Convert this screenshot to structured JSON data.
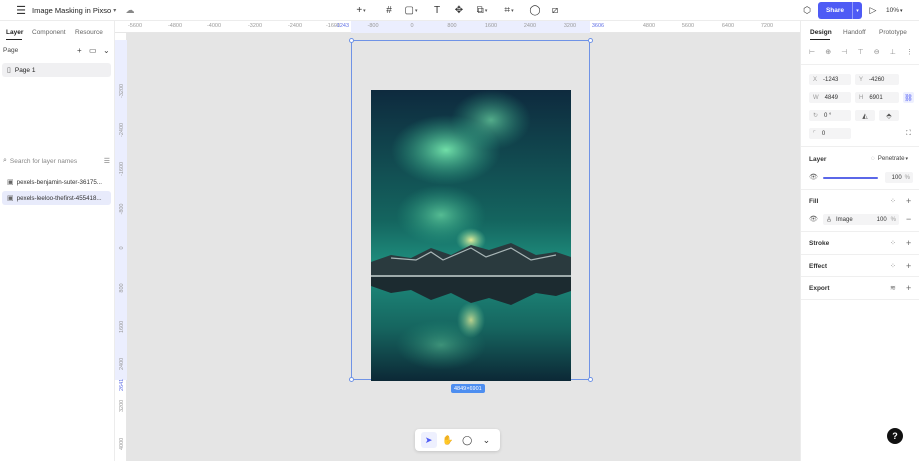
{
  "topbar": {
    "file_title": "Image Masking in Pixso",
    "share_label": "Share",
    "zoom_label": "10%"
  },
  "left_panel": {
    "tabs": [
      "Layer",
      "Component",
      "Resource"
    ],
    "page_header": "Page",
    "pages": [
      "Page 1"
    ],
    "search_placeholder": "Search for layer names",
    "layers": [
      "pexels-benjamin-suter-36175...",
      "pexels-leeloo-thefirst-455418..."
    ]
  },
  "ruler": {
    "top_ticks": [
      "-5600",
      "-4800",
      "-4000",
      "-3200",
      "-2400",
      "-1600",
      "-1243",
      "-800",
      "0",
      "800",
      "1600",
      "2400",
      "3200",
      "3606",
      "4800",
      "5600",
      "6400",
      "7200"
    ],
    "left_ticks": [
      "-3200",
      "-2400",
      "-1600",
      "-800",
      "0",
      "800",
      "1600",
      "2400",
      "2641",
      "3200",
      "4000"
    ]
  },
  "canvas": {
    "size_badge": "4849×6901"
  },
  "right_panel": {
    "tabs": [
      "Design",
      "Handoff",
      "Prototype"
    ],
    "x_label": "X",
    "x_value": "-1243",
    "y_label": "Y",
    "y_value": "-4260",
    "w_label": "W",
    "w_value": "4849",
    "h_label": "H",
    "h_value": "6901",
    "rotation_value": "0 °",
    "radius_value": "0",
    "layer_title": "Layer",
    "blend_mode": "Penetrate",
    "opacity_value": "100",
    "opacity_unit": "%",
    "fill_title": "Fill",
    "fill_type": "Image",
    "fill_opacity": "100",
    "fill_unit": "%",
    "stroke_title": "Stroke",
    "effect_title": "Effect",
    "export_title": "Export"
  },
  "accent_color": "#4e5bf5"
}
